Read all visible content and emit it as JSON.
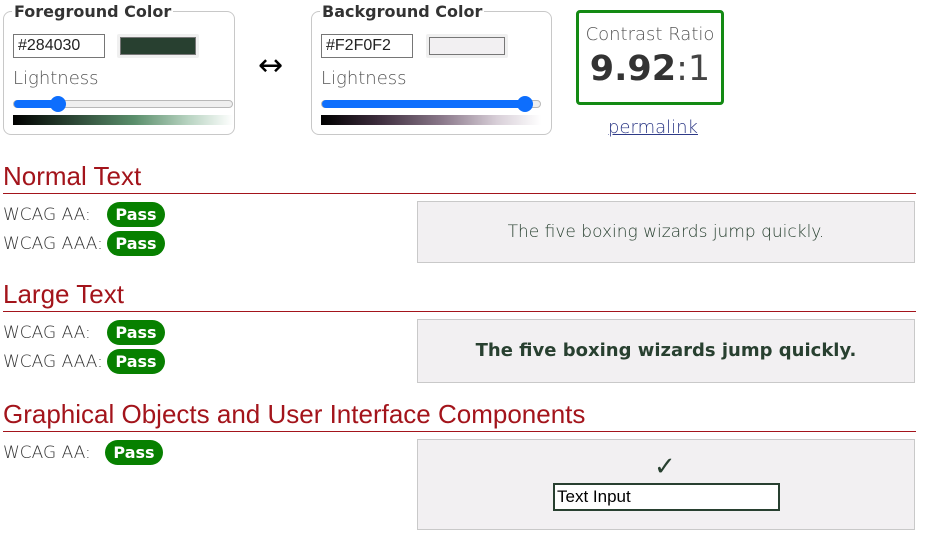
{
  "foreground": {
    "legend": "Foreground Color",
    "hex": "#284030",
    "swatch_color": "#284030",
    "lightness_label": "Lightness",
    "lightness_percent": 20
  },
  "background": {
    "legend": "Background Color",
    "hex": "#F2F0F2",
    "swatch_color": "#F2F0F2",
    "lightness_label": "Lightness",
    "lightness_percent": 93
  },
  "swap_icon": "↔",
  "contrast": {
    "label": "Contrast Ratio",
    "value": "9.92",
    "suffix": ":1",
    "border_color": "#138a13"
  },
  "permalink": "permalink",
  "normal_text": {
    "title": "Normal Text",
    "aa_label": "WCAG AA:",
    "aa_result": "Pass",
    "aaa_label": "WCAG AAA:",
    "aaa_result": "Pass",
    "sample": "The five boxing wizards jump quickly."
  },
  "large_text": {
    "title": "Large Text",
    "aa_label": "WCAG AA:",
    "aa_result": "Pass",
    "aaa_label": "WCAG AAA:",
    "aaa_result": "Pass",
    "sample": "The five boxing wizards jump quickly."
  },
  "graphical": {
    "title": "Graphical Objects and User Interface Components",
    "aa_label": "WCAG AA:",
    "aa_result": "Pass",
    "check_icon": "✓",
    "input_value": "Text Input"
  },
  "colors": {
    "pass": "#078000",
    "heading": "#a3141b",
    "slider": "#0d6efd"
  }
}
